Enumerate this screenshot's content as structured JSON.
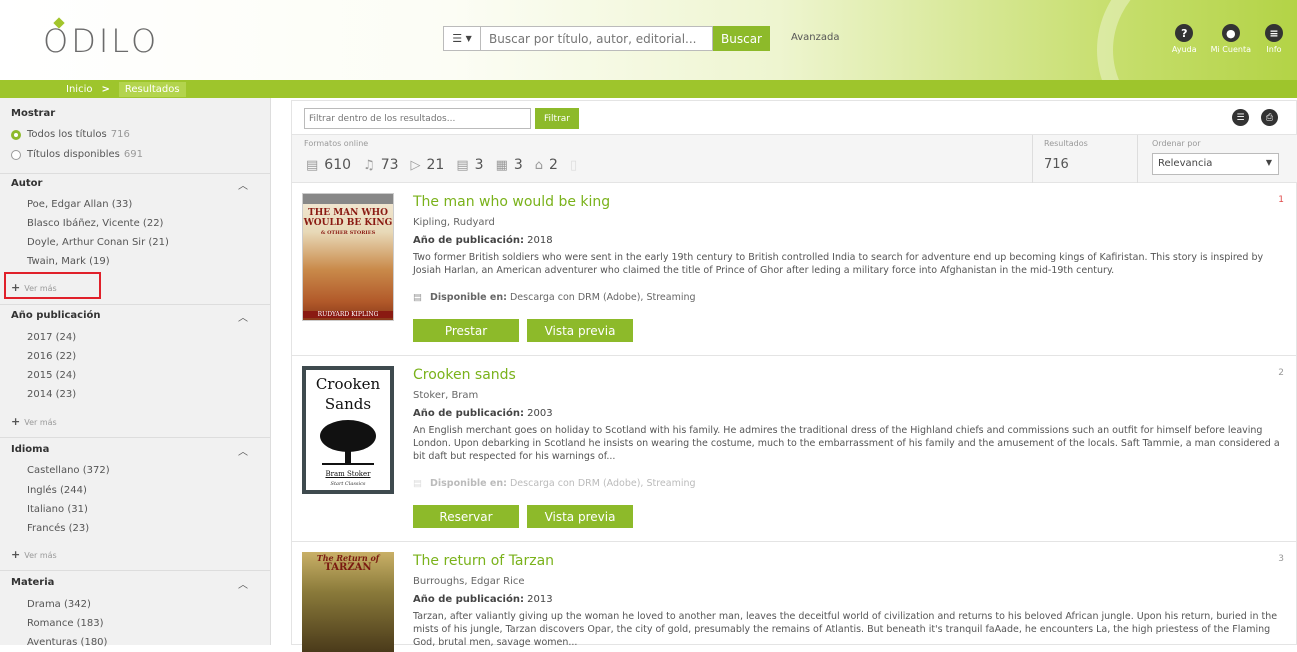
{
  "header": {
    "logo": "ODILO",
    "search_type_icon": "list-icon",
    "search_placeholder": "Buscar por título, autor, editorial...",
    "search_button": "Buscar",
    "advanced": "Avanzada",
    "icons": [
      {
        "name": "help-icon",
        "label": "Ayuda",
        "glyph": "?"
      },
      {
        "name": "account-icon",
        "label": "Mi Cuenta",
        "glyph": "●"
      },
      {
        "name": "info-icon",
        "label": "Info",
        "glyph": "≡"
      }
    ]
  },
  "breadcrumb": {
    "home": "Inicio",
    "sep": ">",
    "current": "Resultados"
  },
  "sidebar": {
    "mostrar": {
      "title": "Mostrar",
      "options": [
        {
          "label": "Todos los títulos",
          "count": "716",
          "selected": true
        },
        {
          "label": "Títulos disponibles",
          "count": "691",
          "selected": false
        }
      ]
    },
    "autor": {
      "title": "Autor",
      "items": [
        "Poe, Edgar Allan (33)",
        "Blasco Ibáñez, Vicente (22)",
        "Doyle, Arthur Conan Sir (21)",
        "Twain, Mark (19)"
      ],
      "more": "Ver más"
    },
    "anio": {
      "title": "Año publicación",
      "items": [
        "2017 (24)",
        "2016 (22)",
        "2015 (24)",
        "2014 (23)"
      ],
      "more": "Ver más"
    },
    "idioma": {
      "title": "Idioma",
      "items": [
        "Castellano (372)",
        "Inglés (244)",
        "Italiano (31)",
        "Francés (23)"
      ],
      "more": "Ver más"
    },
    "materia": {
      "title": "Materia",
      "items": [
        "Drama (342)",
        "Romance (183)",
        "Aventuras (180)"
      ]
    }
  },
  "toolbar": {
    "filter_placeholder": "Filtrar dentro de los resultados...",
    "filter_button": "Filtrar"
  },
  "formats": {
    "label": "Formatos online",
    "items": [
      {
        "icon": "ebook-icon",
        "glyph": "▤",
        "count": "610"
      },
      {
        "icon": "audiobook-icon",
        "glyph": "♫",
        "count": "73"
      },
      {
        "icon": "video-icon",
        "glyph": "▷",
        "count": "21"
      },
      {
        "icon": "document-icon",
        "glyph": "▤",
        "count": "3"
      },
      {
        "icon": "magazine-icon",
        "glyph": "▦",
        "count": "3"
      },
      {
        "icon": "course-icon",
        "glyph": "⌂",
        "count": "2"
      },
      {
        "icon": "other-format-icon",
        "glyph": "▯",
        "count": ""
      }
    ],
    "results_label": "Resultados",
    "results_value": "716",
    "order_label": "Ordenar por",
    "order_value": "Relevancia"
  },
  "results": [
    {
      "number": "1",
      "title": "The man who would be king",
      "author": "Kipling, Rudyard",
      "year_label": "Año de publicación:",
      "year": "2018",
      "description": "Two former British soldiers who were sent in the early 19th century to British controlled India to search for adventure end up becoming kings of Kafiristan. This story is inspired by Josiah Harlan, an American adventurer who claimed the title of Prince of Ghor after leding a military force into Afghanistan in the mid-19th century.",
      "avail_label": "Disponible en:",
      "avail": "Descarga con DRM (Adobe), Streaming",
      "button1": "Prestar",
      "button2": "Vista previa",
      "cover_lines": [
        "THE MAN WHO",
        "WOULD BE KING",
        "& OTHER STORIES",
        "RUDYARD KIPLING"
      ]
    },
    {
      "number": "2",
      "title": "Crooken sands",
      "author": "Stoker, Bram",
      "year_label": "Año de publicación:",
      "year": "2003",
      "description": "An English merchant goes on holiday to Scotland with his family. He admires the traditional dress of the Highland chiefs and commissions such an outfit for himself before leaving London. Upon debarking in Scotland he insists on wearing the costume, much to the embarrassment of his family and the amusement of the locals. Saft Tammie, a man considered a bit daft but respected for his warnings of...",
      "avail_label": "Disponible en:",
      "avail": "Descarga con DRM (Adobe), Streaming",
      "button1": "Reservar",
      "button2": "Vista previa",
      "cover_lines": [
        "Crooken",
        "Sands",
        "Bram Stoker",
        "Start Classics"
      ]
    },
    {
      "number": "3",
      "title": "The return of Tarzan",
      "author": "Burroughs, Edgar Rice",
      "year_label": "Año de publicación:",
      "year": "2013",
      "description": "Tarzan, after valiantly giving up the woman he loved to another man, leaves the deceitful world of civilization and returns to his beloved African jungle. Upon his return, buried in the mists of his jungle, Tarzan discovers Opar, the city of gold, presumably the remains of Atlantis. But beneath it's tranquil faAade, he encounters La, the high priestess of the Flaming God, brutal men, savage women...",
      "cover_lines": [
        "The Return of",
        "TARZAN"
      ]
    }
  ]
}
